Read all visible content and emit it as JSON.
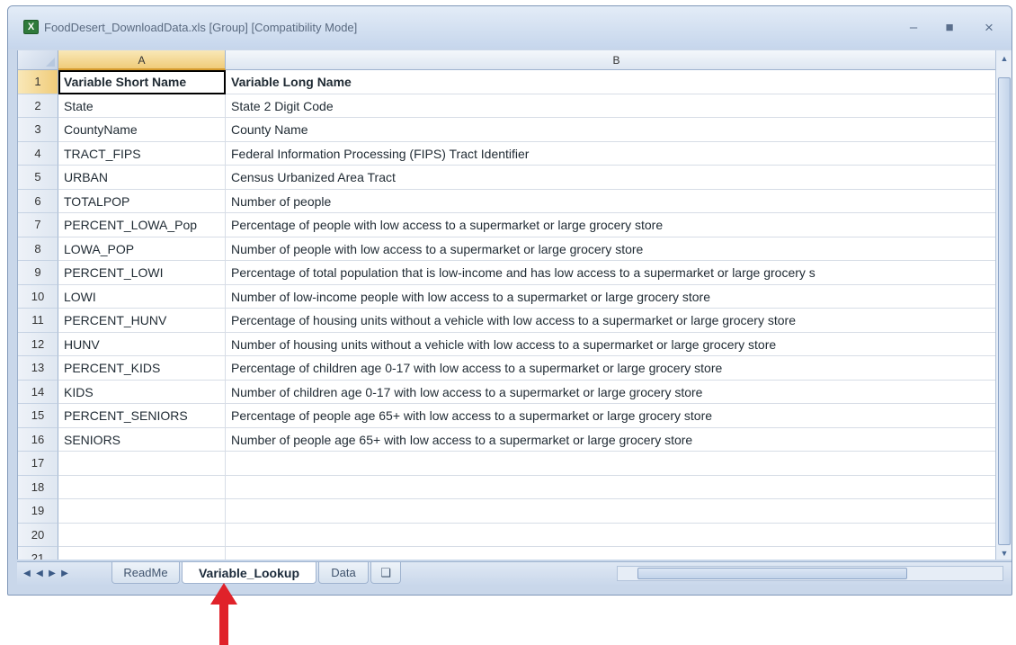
{
  "window": {
    "title": "FoodDesert_DownloadData.xls [Group] [Compatibility Mode]",
    "icon": "excel-icon",
    "controls": [
      "minimize-icon",
      "maximize-icon",
      "close-icon"
    ]
  },
  "columns": [
    "A",
    "B"
  ],
  "rows": [
    {
      "num": "1",
      "a": "Variable Short Name",
      "b": "Variable Long Name"
    },
    {
      "num": "2",
      "a": "State",
      "b": "State 2 Digit Code"
    },
    {
      "num": "3",
      "a": "CountyName",
      "b": "County Name"
    },
    {
      "num": "4",
      "a": "TRACT_FIPS",
      "b": "Federal Information Processing (FIPS) Tract Identifier"
    },
    {
      "num": "5",
      "a": "URBAN",
      "b": "Census Urbanized Area Tract"
    },
    {
      "num": "6",
      "a": "TOTALPOP",
      "b": "Number of people"
    },
    {
      "num": "7",
      "a": "PERCENT_LOWA_Pop",
      "b": "Percentage of people with low access to a supermarket or large grocery store"
    },
    {
      "num": "8",
      "a": "LOWA_POP",
      "b": "Number of people with low access to a supermarket or large grocery store"
    },
    {
      "num": "9",
      "a": "PERCENT_LOWI",
      "b": "Percentage of total population that is low-income and has low access to a supermarket or large grocery s"
    },
    {
      "num": "10",
      "a": "LOWI",
      "b": "Number of low-income people with low access to a supermarket or large grocery store"
    },
    {
      "num": "11",
      "a": "PERCENT_HUNV",
      "b": "Percentage of housing units without a vehicle with low access to a supermarket or large grocery store"
    },
    {
      "num": "12",
      "a": "HUNV",
      "b": "Number of housing units without a vehicle with low access to a supermarket or large grocery store"
    },
    {
      "num": "13",
      "a": "PERCENT_KIDS",
      "b": "Percentage of children age 0-17 with low access to a supermarket or large grocery store"
    },
    {
      "num": "14",
      "a": "KIDS",
      "b": "Number of children age 0-17 with low access to a supermarket or large grocery store"
    },
    {
      "num": "15",
      "a": "PERCENT_SENIORS",
      "b": "Percentage of people age 65+ with low access to a supermarket or large grocery store"
    },
    {
      "num": "16",
      "a": "SENIORS",
      "b": "Number of people age 65+ with low access to a supermarket or large grocery store"
    },
    {
      "num": "17",
      "a": "",
      "b": ""
    },
    {
      "num": "18",
      "a": "",
      "b": ""
    },
    {
      "num": "19",
      "a": "",
      "b": ""
    },
    {
      "num": "20",
      "a": "",
      "b": ""
    },
    {
      "num": "21",
      "a": "",
      "b": ""
    }
  ],
  "sheet_tabs": [
    "ReadMe",
    "Variable_Lookup",
    "Data"
  ],
  "active_tab": "Variable_Lookup",
  "annotation_color": "#e0222a"
}
